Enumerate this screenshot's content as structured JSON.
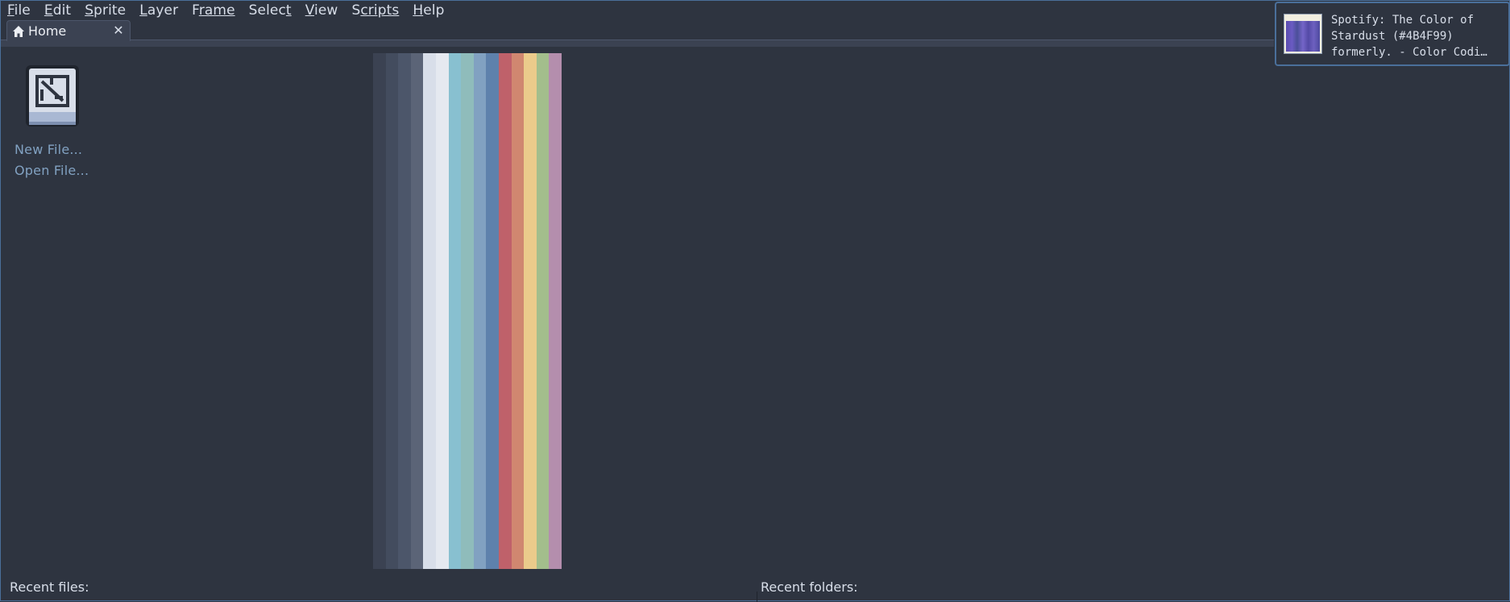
{
  "menubar": {
    "items": [
      {
        "first": "F",
        "rest": "ile",
        "label": "File"
      },
      {
        "first": "E",
        "rest": "dit",
        "label": "Edit"
      },
      {
        "first": "S",
        "rest": "prite",
        "label": "Sprite"
      },
      {
        "first": "L",
        "rest": "ayer",
        "label": "Layer"
      },
      {
        "first": "F",
        "rest": "rame",
        "label": "Frame"
      },
      {
        "first": "Selec",
        "rest": "t",
        "label": "Select",
        "underline_last": true
      },
      {
        "first": "V",
        "rest": "iew",
        "label": "View"
      },
      {
        "first": "S",
        "rest": "cripts",
        "label": "Scripts",
        "underline_second": true
      },
      {
        "first": "H",
        "rest": "elp",
        "label": "Help"
      }
    ]
  },
  "tabs": [
    {
      "label": "Home",
      "icon": "home-icon",
      "close": "✕"
    }
  ],
  "home": {
    "new_file": "New File...",
    "open_file": "Open File...",
    "recent_files": "Recent files:",
    "recent_folders": "Recent folders:"
  },
  "palette": {
    "colors": [
      "#3b4252",
      "#434c5e",
      "#4c566a",
      "#5b6477",
      "#d8dee9",
      "#e5e9f0",
      "#88c0d0",
      "#8fbcbb",
      "#81a1c1",
      "#5e81ac",
      "#bf616a",
      "#d08770",
      "#ebcb8b",
      "#a3be8c",
      "#b48ead"
    ]
  },
  "notification": {
    "lines": [
      "Spotify: The Color of",
      "Stardust (#4B4F99)",
      "formerly. - Color Codi…"
    ]
  },
  "colors": {
    "accent": "#4a6f9a",
    "background": "#2e3440",
    "link": "#81a1c1"
  }
}
